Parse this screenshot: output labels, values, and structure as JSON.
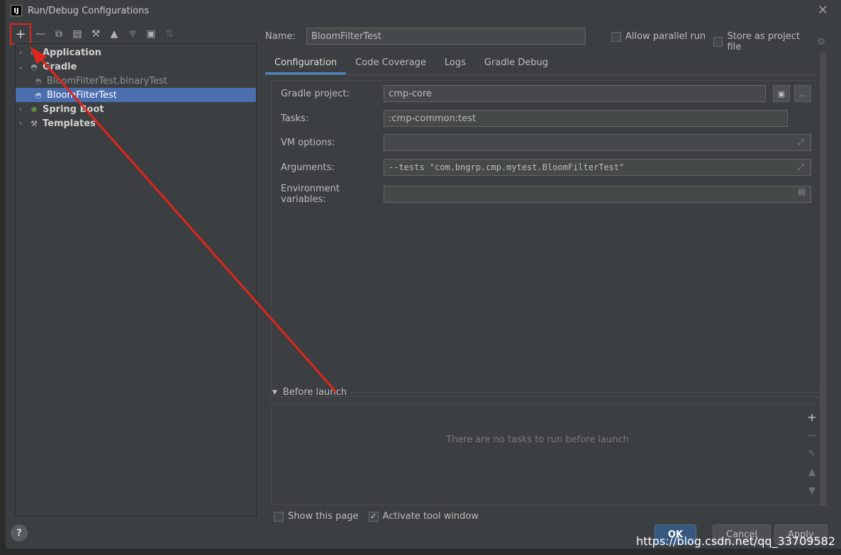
{
  "window": {
    "title": "Run/Debug Configurations",
    "app_icon_label": "IJ"
  },
  "toolbar": {
    "items": [
      "add",
      "remove",
      "copy",
      "save",
      "edit",
      "move-up",
      "move-down",
      "new-folder",
      "sort"
    ]
  },
  "tree": {
    "nodes": [
      {
        "label": "Application",
        "bold": true
      },
      {
        "label": "Gradle",
        "bold": true
      },
      {
        "label": "BloomFilterTest.binaryTest"
      },
      {
        "label": "BloomFilterTest",
        "selected": true
      },
      {
        "label": "Spring Boot",
        "bold": true
      },
      {
        "label": "Templates",
        "bold": true
      }
    ]
  },
  "name_field": {
    "label": "Name:",
    "value": "BloomFilterTest"
  },
  "options": {
    "parallel": "Allow parallel run",
    "store": "Store as project file"
  },
  "tabs": [
    "Configuration",
    "Code Coverage",
    "Logs",
    "Gradle Debug"
  ],
  "fields": {
    "gradle_project": {
      "label": "Gradle project:",
      "value": "cmp-core"
    },
    "tasks": {
      "label": "Tasks:",
      "value": ":cmp-common:test"
    },
    "vm_options": {
      "label": "VM options:",
      "value": ""
    },
    "arguments": {
      "label": "Arguments:",
      "value": "--tests \"com.bngrp.cmp.mytest.BloomFilterTest\""
    },
    "env": {
      "label": "Environment variables:",
      "value": ""
    }
  },
  "before_launch": {
    "title": "Before launch",
    "empty": "There are no tasks to run before launch"
  },
  "bottom": {
    "show_page": "Show this page",
    "activate": "Activate tool window"
  },
  "buttons": {
    "ok": "OK",
    "cancel": "Cancel",
    "apply": "Apply",
    "help": "?"
  },
  "watermark": "https://blog.csdn.net/qq_33709582",
  "annotation": {
    "color": "#e0251b"
  }
}
